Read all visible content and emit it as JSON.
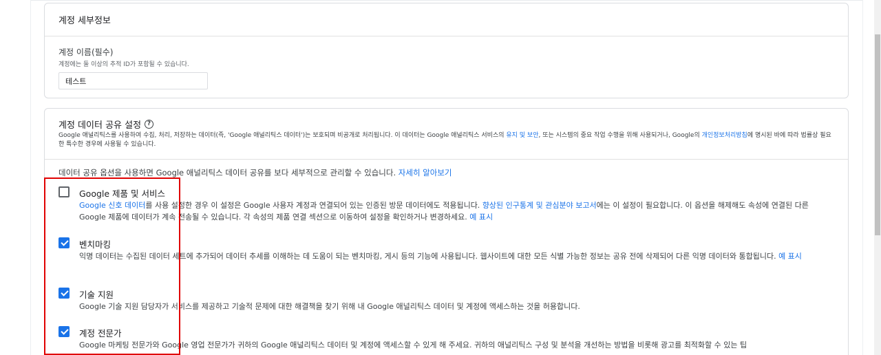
{
  "account_details": {
    "title": "계정 세부정보",
    "name_label": "계정 이름(필수)",
    "name_help": "계정에는 둘 이상의 추적 ID가 포함될 수 있습니다.",
    "name_value": "테스트"
  },
  "data_sharing": {
    "title": "계정 데이터 공유 설정",
    "desc_part1": "Google 애널리틱스를 사용하여 수집, 처리, 저장하는 데이터(즉, 'Google 애널리틱스 데이터')는 보호되며 비공개로 처리됩니다. 이 데이터는 Google 애널리틱스 서비스의 ",
    "desc_link1": "유지 및 보안",
    "desc_part2": ", 또는 시스템의 중요 작업 수행을 위해 사용되거나, Google의 ",
    "desc_link2": "개인정보처리방침",
    "desc_part3": "에 명시된 바에 따라 법률상 필요한 특수한 경우에 사용될 수 있습니다.",
    "intro_text": "데이터 공유 옵션을 사용하면 Google 애널리틱스 데이터 공유를 보다 세부적으로 관리할 수 있습니다. ",
    "intro_link": "자세히 알아보기",
    "options": [
      {
        "title": "Google 제품 및 서비스",
        "checked": false,
        "desc_link_a": "Google 신호 데이터",
        "desc_part_a": "를 사용 설정한 경우 이 설정은 Google 사용자 계정과 연결되어 있는 인증된 방문 데이터에도 적용됩니다. ",
        "desc_link_b": "향상된 인구통계 및 관심분야 보고서",
        "desc_part_b": "에는 이 설정이 필요합니다. 이 옵션을 해제해도 속성에 연결된 다른 Google 제품에 데이터가 계속 전송될 수 있습니다. 각 속성의 제품 연결 섹션으로 이동하여 설정을 확인하거나 변경하세요. ",
        "desc_link_c": "예 표시"
      },
      {
        "title": "벤치마킹",
        "checked": true,
        "desc": "익명 데이터는 수집된 데이터 세트에 추가되어 데이터 추세를 이해하는 데 도움이 되는 벤치마킹, 게시 등의 기능에 사용됩니다. 웹사이트에 대한 모든 식별 가능한 정보는 공유 전에 삭제되어 다른 익명 데이터와 통합됩니다. ",
        "desc_link": "예 표시"
      },
      {
        "title": "기술 지원",
        "checked": true,
        "desc": "Google 기술 지원 담당자가 서비스를 제공하고 기술적 문제에 대한 해결책을 찾기 위해 내 Google 애널리틱스 데이터 및 계정에 액세스하는 것을 허용합니다."
      },
      {
        "title": "계정 전문가",
        "checked": true,
        "desc": "Google 마케팅 전문가와 Google 영업 전문가가 귀하의 Google 애널리틱스 데이터 및 계정에 액세스할 수 있게 해 주세요. 귀하의 애널리틱스 구성 및 분석을 개선하는 방법을 비롯해 광고를 최적화할 수 있는 팁"
      }
    ]
  },
  "colors": {
    "link": "#1a73e8",
    "checkbox_checked": "#1a73e8",
    "highlight": "#e00000"
  }
}
